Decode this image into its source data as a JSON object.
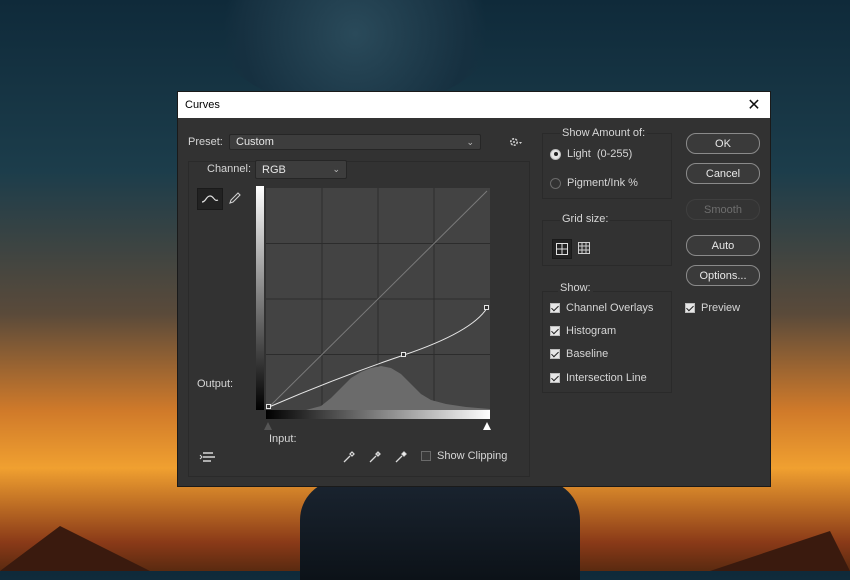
{
  "window": {
    "title": "Curves",
    "close_symbol": "✕"
  },
  "preset": {
    "label": "Preset:",
    "value": "Custom"
  },
  "channel": {
    "label": "Channel:",
    "value": "RGB"
  },
  "graph": {
    "output_label": "Output:",
    "input_label": "Input:"
  },
  "show_clipping": {
    "label": "Show Clipping",
    "checked": false
  },
  "show_amount": {
    "heading": "Show Amount of:",
    "light": {
      "label": "Light",
      "range": "(0-255)",
      "selected": true
    },
    "pigment": {
      "label": "Pigment/Ink %",
      "selected": false
    }
  },
  "grid_size": {
    "heading": "Grid size:"
  },
  "show": {
    "heading": "Show:",
    "channel_overlays": "Channel Overlays",
    "histogram": "Histogram",
    "baseline": "Baseline",
    "intersection_line": "Intersection Line"
  },
  "buttons": {
    "ok": "OK",
    "cancel": "Cancel",
    "smooth": "Smooth",
    "auto": "Auto",
    "options": "Options..."
  },
  "preview": {
    "label": "Preview",
    "checked": true
  },
  "colors": {
    "dialog_bg": "#323232",
    "graph_bg": "#434343",
    "histogram": "#6b6b6b",
    "curve": "#e6e6e6"
  }
}
